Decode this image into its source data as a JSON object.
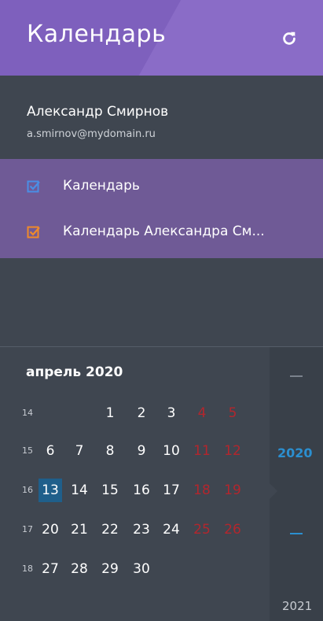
{
  "header": {
    "title": "Календарь",
    "refresh_icon": "refresh-icon"
  },
  "account": {
    "name": "Александр Смирнов",
    "email": "a.smirnov@mydomain.ru"
  },
  "calendars": [
    {
      "label": "Календарь",
      "color": "#4a8fe6",
      "checked": true
    },
    {
      "label": "Календарь Александра См...",
      "color": "#f08a2a",
      "checked": true
    }
  ],
  "mini_calendar": {
    "month_title": "апрель 2020",
    "weeks": [
      {
        "num": "14",
        "days": [
          "",
          "",
          "1",
          "2",
          "3",
          "4",
          "5"
        ]
      },
      {
        "num": "15",
        "days": [
          "6",
          "7",
          "8",
          "9",
          "10",
          "11",
          "12"
        ]
      },
      {
        "num": "16",
        "days": [
          "13",
          "14",
          "15",
          "16",
          "17",
          "18",
          "19"
        ]
      },
      {
        "num": "17",
        "days": [
          "20",
          "21",
          "22",
          "23",
          "24",
          "25",
          "26"
        ]
      },
      {
        "num": "18",
        "days": [
          "27",
          "28",
          "29",
          "30",
          "",
          "",
          ""
        ]
      }
    ],
    "today": "13"
  },
  "years": {
    "current": "2020",
    "next": "2021"
  },
  "colors": {
    "header": "#8a6cc7",
    "list": "#6f5a96",
    "bg": "#3f4650",
    "today": "#1f5f8b",
    "weekend": "#b3262d",
    "year_accent": "#2b8fd0"
  }
}
